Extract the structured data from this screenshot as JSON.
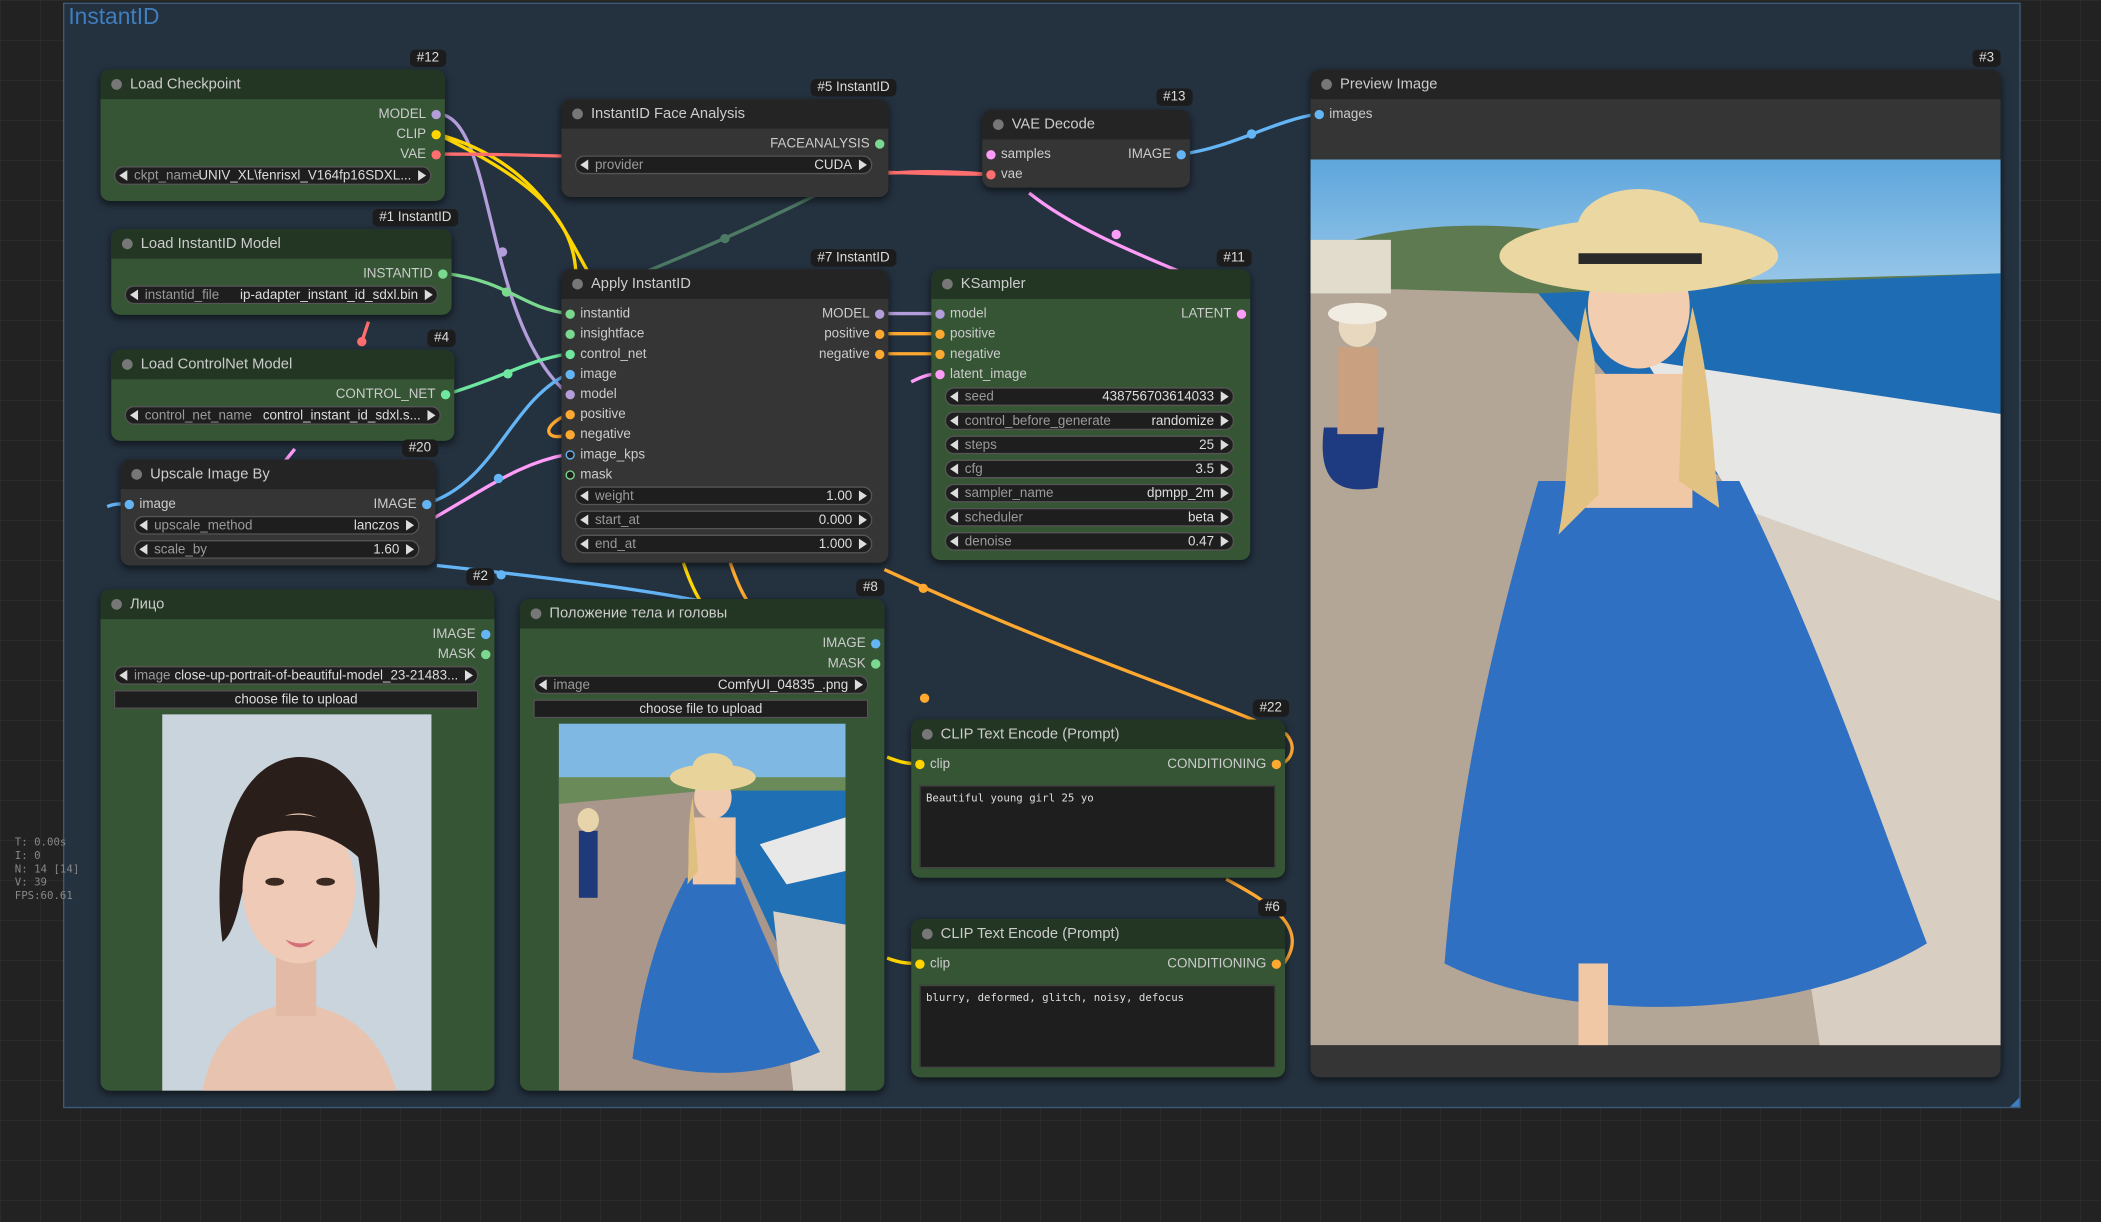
{
  "group": {
    "title": "InstantID"
  },
  "stats": {
    "t": "T: 0.00s",
    "i": "I: 0",
    "n": "N: 14 [14]",
    "v": "V: 39",
    "fps": "FPS:60.61"
  },
  "colors": {
    "model": "#b39ddb",
    "clip": "#ffd500",
    "vae": "#ff6e6e",
    "image": "#64b5f6",
    "conditioning": "#ffa931",
    "latent": "#ff9cf9",
    "control_net": "#6ee7a0",
    "instantid": "#7bd88f"
  },
  "nodes": {
    "load_checkpoint": {
      "badge": "#12",
      "title": "Load Checkpoint",
      "out_model": "MODEL",
      "out_clip": "CLIP",
      "out_vae": "VAE",
      "ckpt_label": "ckpt_name",
      "ckpt_value": "UNIV_XL\\fenrisxl_V164fp16SDXL..."
    },
    "load_instantid": {
      "badge": "#1 InstantID",
      "title": "Load InstantID Model",
      "out": "INSTANTID",
      "file_label": "instantid_file",
      "file_value": "ip-adapter_instant_id_sdxl.bin"
    },
    "load_controlnet": {
      "badge": "#4",
      "title": "Load ControlNet Model",
      "out": "CONTROL_NET",
      "cn_label": "control_net_name",
      "cn_value": "control_instant_id_sdxl.s..."
    },
    "upscale": {
      "badge": "#20",
      "title": "Upscale Image By",
      "in_image": "image",
      "out_image": "IMAGE",
      "method_label": "upscale_method",
      "method_value": "lanczos",
      "scale_label": "scale_by",
      "scale_value": "1.60"
    },
    "face_analysis": {
      "badge": "#5 InstantID",
      "title": "InstantID Face Analysis",
      "out": "FACEANALYSIS",
      "provider_label": "provider",
      "provider_value": "CUDA"
    },
    "apply_instantid": {
      "badge": "#7 InstantID",
      "title": "Apply InstantID",
      "inputs": [
        "instantid",
        "insightface",
        "control_net",
        "image",
        "model",
        "positive",
        "negative",
        "image_kps",
        "mask"
      ],
      "outputs": [
        "MODEL",
        "positive",
        "negative"
      ],
      "weight_label": "weight",
      "weight_value": "1.00",
      "start_label": "start_at",
      "start_value": "0.000",
      "end_label": "end_at",
      "end_value": "1.000"
    },
    "vae_decode": {
      "badge": "#13",
      "title": "VAE Decode",
      "in_samples": "samples",
      "in_vae": "vae",
      "out": "IMAGE"
    },
    "ksampler": {
      "badge": "#11",
      "title": "KSampler",
      "inputs": [
        "model",
        "positive",
        "negative",
        "latent_image"
      ],
      "out": "LATENT",
      "widgets": [
        {
          "label": "seed",
          "value": "438756703614033"
        },
        {
          "label": "control_before_generate",
          "value": "randomize"
        },
        {
          "label": "steps",
          "value": "25"
        },
        {
          "label": "cfg",
          "value": "3.5"
        },
        {
          "label": "sampler_name",
          "value": "dpmpp_2m"
        },
        {
          "label": "scheduler",
          "value": "beta"
        },
        {
          "label": "denoise",
          "value": "0.47"
        }
      ]
    },
    "face_image": {
      "badge": "#2",
      "title": "Лицо",
      "out_image": "IMAGE",
      "out_mask": "MASK",
      "image_label": "image",
      "image_value": "close-up-portrait-of-beautiful-model_23-21483...",
      "upload": "choose file to upload"
    },
    "pose_image": {
      "badge": "#8",
      "title": "Положение тела и головы",
      "out_image": "IMAGE",
      "out_mask": "MASK",
      "image_label": "image",
      "image_value": "ComfyUI_04835_.png",
      "upload": "choose file to upload"
    },
    "clip_pos": {
      "badge": "#22",
      "title": "CLIP Text Encode (Prompt)",
      "in": "clip",
      "out": "CONDITIONING",
      "text": "Beautiful young girl 25 yo"
    },
    "clip_neg": {
      "badge": "#6",
      "title": "CLIP Text Encode (Prompt)",
      "in": "clip",
      "out": "CONDITIONING",
      "text": "blurry, deformed, glitch, noisy, defocus"
    },
    "preview": {
      "badge": "#3",
      "title": "Preview Image",
      "in": "images"
    }
  }
}
